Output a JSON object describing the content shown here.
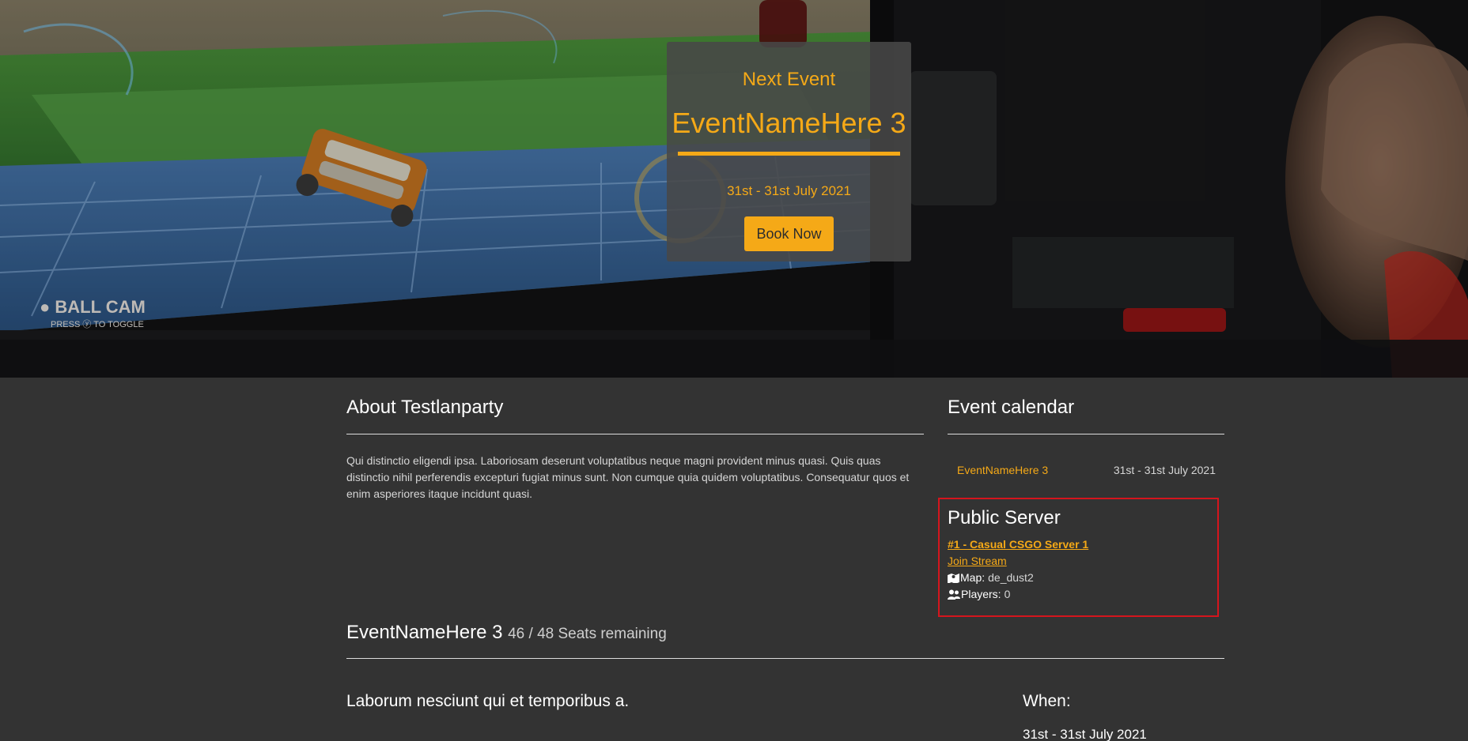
{
  "hero": {
    "next_event_label": "Next Event",
    "event_name": "EventNameHere 3",
    "event_date": "31st - 31st July 2021",
    "book_button": "Book Now"
  },
  "about": {
    "title": "About Testlanparty",
    "text": "Qui distinctio eligendi ipsa. Laboriosam deserunt voluptatibus neque magni provident minus quasi. Quis quas distinctio nihil perferendis excepturi fugiat minus sunt. Non cumque quia quidem voluptatibus. Consequatur quos et enim asperiores itaque incidunt quasi."
  },
  "calendar": {
    "title": "Event calendar",
    "events": [
      {
        "name": "EventNameHere 3",
        "date": "31st - 31st July 2021"
      }
    ]
  },
  "server": {
    "title": "Public Server",
    "server_name": "#1 - Casual CSGO Server 1",
    "stream_link": "Join Stream",
    "map_label": "Map:",
    "map_value": "de_dust2",
    "players_label": "Players:",
    "players_value": "0"
  },
  "event": {
    "name": "EventNameHere 3",
    "seats": "46 / 48 Seats remaining",
    "description": "Laborum nesciunt qui et temporibus a.",
    "when_label": "When:",
    "when_date": "31st - 31st July 2021"
  },
  "colors": {
    "accent": "#f5a917",
    "background": "#333333",
    "highlight_border": "#d5151d"
  },
  "icons": {
    "map": "map-marked-icon",
    "players": "users-icon"
  }
}
